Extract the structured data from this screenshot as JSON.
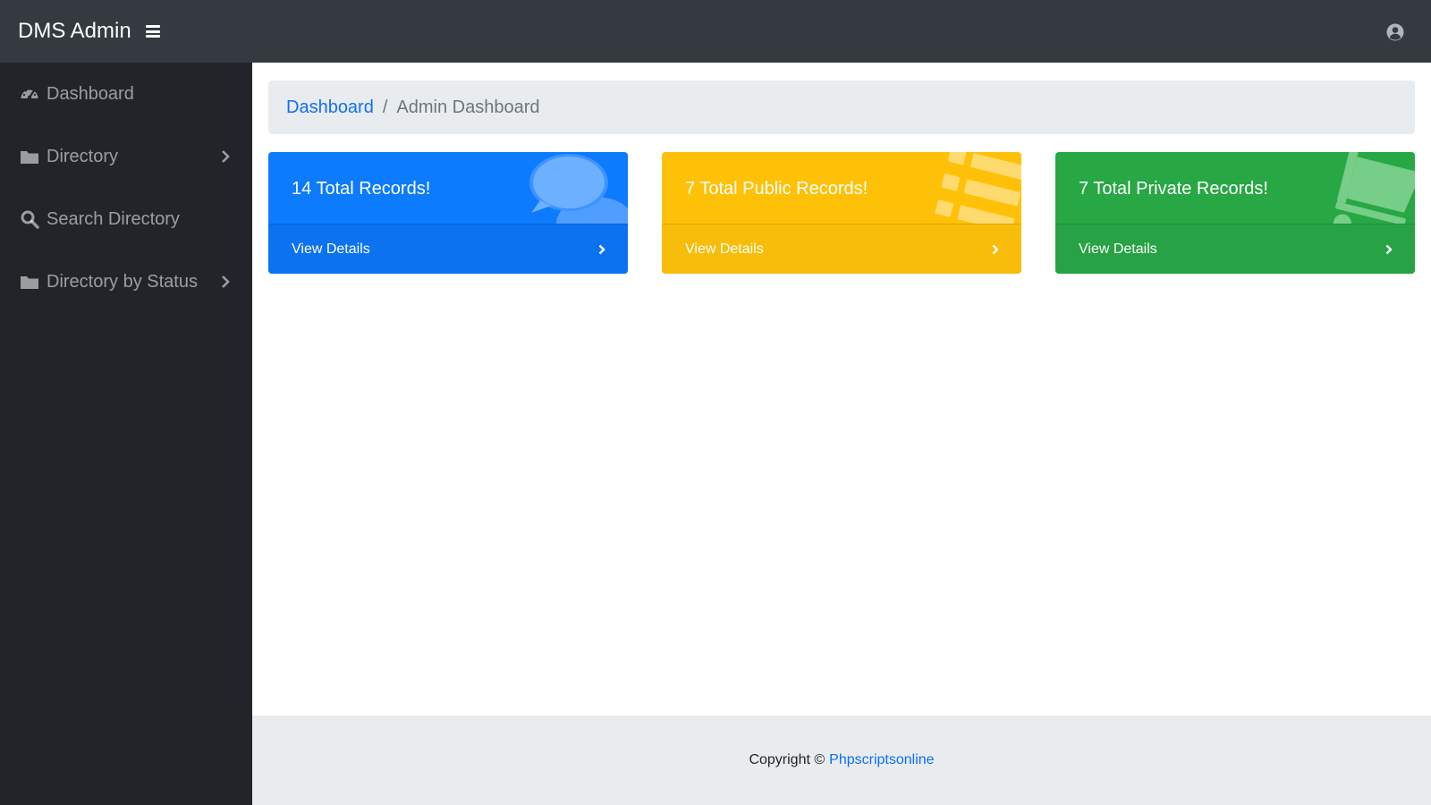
{
  "header": {
    "brand": "DMS Admin",
    "menu_icon": "hamburger-icon",
    "user_icon": "user-circle-icon"
  },
  "sidebar": {
    "items": [
      {
        "label": "Dashboard",
        "icon": "tachometer-icon",
        "has_submenu": false
      },
      {
        "label": "Directory",
        "icon": "folder-icon",
        "has_submenu": true
      },
      {
        "label": "Search Directory",
        "icon": "search-icon",
        "has_submenu": false
      },
      {
        "label": "Directory by Status",
        "icon": "folder-icon",
        "has_submenu": true
      }
    ]
  },
  "breadcrumb": {
    "link": "Dashboard",
    "separator": "/",
    "active": "Admin Dashboard"
  },
  "cards": [
    {
      "title": "14 Total Records!",
      "footer": "View Details",
      "color": "#0d7bfd",
      "icon": "comments-icon"
    },
    {
      "title": "7 Total Public Records!",
      "footer": "View Details",
      "color": "#ffc107",
      "icon": "list-icon"
    },
    {
      "title": "7 Total Private Records!",
      "footer": "View Details",
      "color": "#28a745",
      "icon": "shopping-cart-icon"
    }
  ],
  "footer": {
    "text": "Copyright ©",
    "link": "Phpscriptsonline"
  }
}
